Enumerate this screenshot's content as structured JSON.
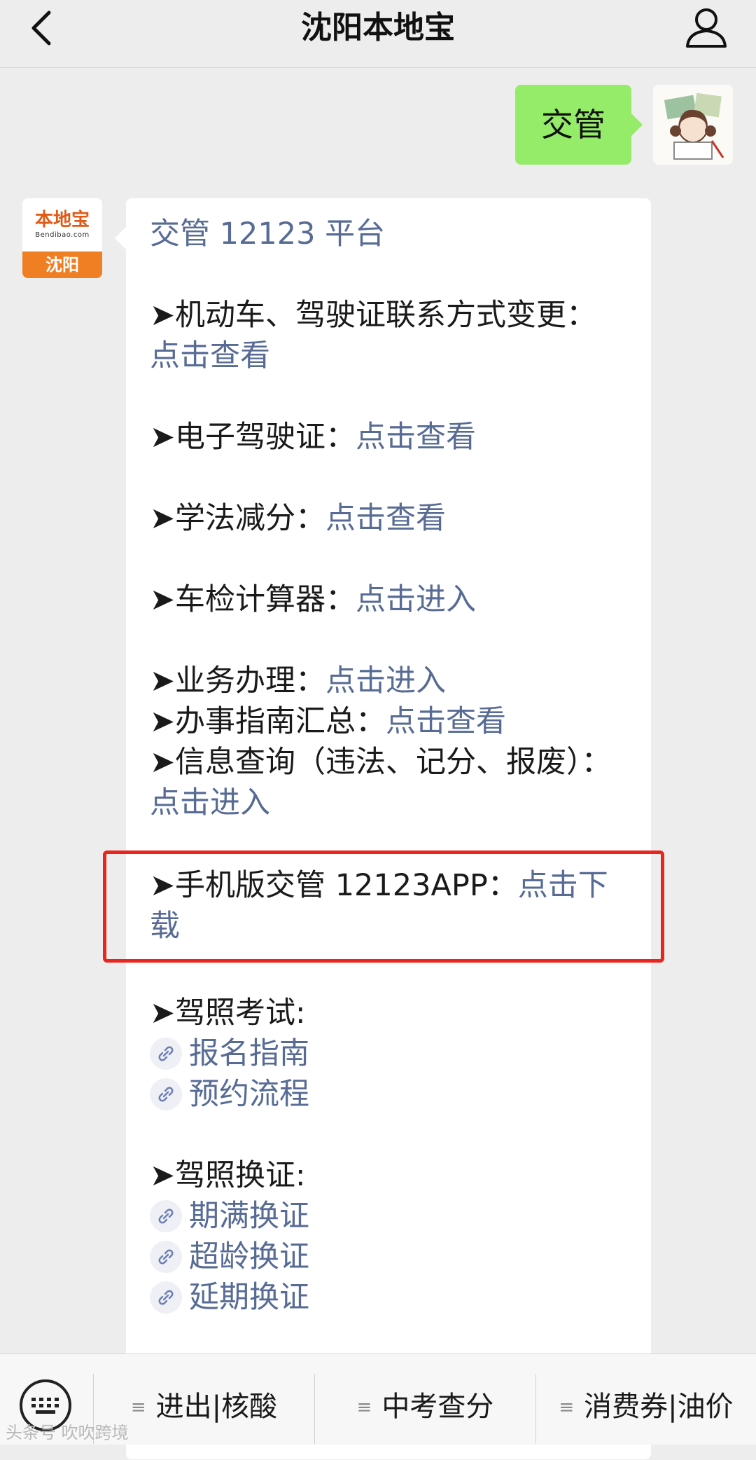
{
  "header": {
    "title": "沈阳本地宝"
  },
  "sent_message": {
    "text": "交管"
  },
  "bot": {
    "avatar_logo": "本地宝",
    "avatar_site": "Bendibao.com",
    "avatar_city": "沈阳"
  },
  "reply": {
    "heading": "交管 12123 平台",
    "items": [
      {
        "label": "➤机动车、驾驶证联系方式变更：",
        "link": "点击查看"
      },
      {
        "label": "➤电子驾驶证：",
        "link": "点击查看"
      },
      {
        "label": "➤学法减分：",
        "link": "点击查看"
      },
      {
        "label": "➤车检计算器：",
        "link": "点击进入"
      },
      {
        "label": "➤业务办理：",
        "link": "点击进入"
      },
      {
        "label": "➤办事指南汇总：",
        "link": "点击查看"
      },
      {
        "label": "➤信息查询（违法、记分、报废）：",
        "link": "点击进入"
      },
      {
        "label": "➤手机版交管 12123APP：",
        "link": "点击下载"
      }
    ],
    "exam": {
      "label": "➤驾照考试:",
      "links": [
        "报名指南",
        "预约流程"
      ]
    },
    "renew": {
      "label": "➤驾照换证:",
      "links": [
        "期满换证",
        "超龄换证",
        "延期换证"
      ]
    }
  },
  "menu": {
    "items": [
      "进出|核酸",
      "中考查分",
      "消费券|油价"
    ]
  },
  "watermark": "头条号 吹吹跨境"
}
